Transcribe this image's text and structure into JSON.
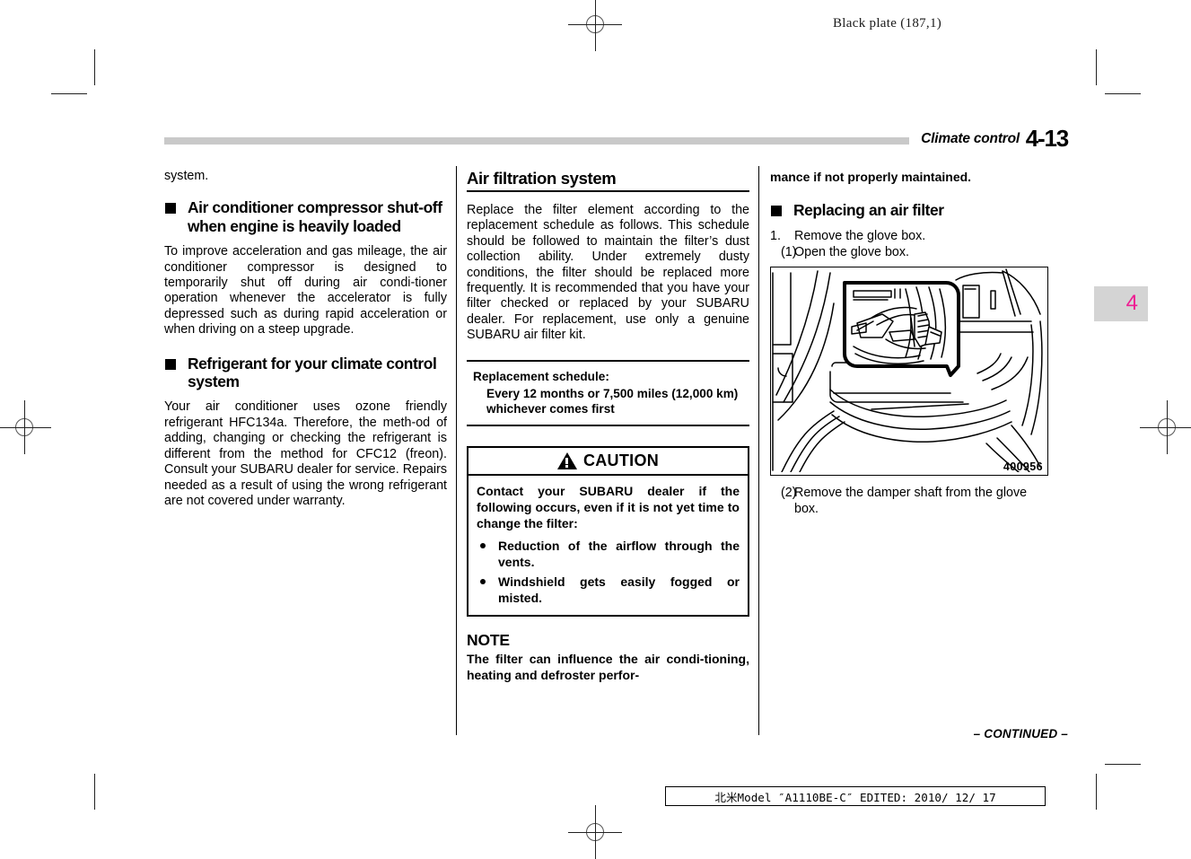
{
  "print_marks": {
    "black_plate": "Black plate (187,1)"
  },
  "running_head": {
    "title": "Climate control",
    "page_number": "4-13"
  },
  "chapter_tab": {
    "number": "4",
    "color": "#ee1d92"
  },
  "column1": {
    "continued_text": "system.",
    "heading1": "Air conditioner compressor shut-off when engine is heavily loaded",
    "paragraph1": "To improve acceleration and gas mileage, the air conditioner compressor is designed to temporarily shut off during air condi-tioner operation whenever the accelerator is fully depressed such as during rapid acceleration or when driving on a steep upgrade.",
    "heading2": "Refrigerant for your climate control system",
    "paragraph2": "Your air conditioner uses ozone friendly refrigerant HFC134a. Therefore, the meth-od of adding, changing or checking the refrigerant is different from the method for CFC12 (freon). Consult your SUBARU dealer for service. Repairs needed as a result of using the wrong refrigerant are not covered under warranty."
  },
  "column2": {
    "section_title": "Air filtration system",
    "paragraph1": "Replace the filter element according to the replacement schedule as follows. This schedule should be followed to maintain the filter’s dust collection ability. Under extremely dusty conditions, the filter should be replaced more frequently. It is recommended that you have your filter checked or replaced by your SUBARU dealer. For replacement, use only a genuine SUBARU air filter kit.",
    "schedule": {
      "title": "Replacement schedule:",
      "detail": "Every 12 months or 7,500 miles (12,000 km) whichever comes first"
    },
    "caution": {
      "label": "CAUTION",
      "icon": "warning-triangle-icon",
      "intro": "Contact your SUBARU dealer if the following occurs, even if it is not yet time to change the filter:",
      "items": [
        "Reduction of the airflow through the vents.",
        "Windshield gets easily fogged or misted."
      ]
    },
    "note": {
      "label": "NOTE",
      "text": "The filter can influence the air condi-tioning, heating and defroster perfor-"
    }
  },
  "column3": {
    "continued_text": "mance if not properly maintained.",
    "heading1": "Replacing an air filter",
    "step1_num": "1.",
    "step1_text": "Remove the glove box.",
    "substep1_num": "(1)",
    "substep1_text": "Open the glove box.",
    "figure_id": "400956",
    "substep2_num": "(2)",
    "substep2_text": "Remove the damper shaft from the glove box."
  },
  "footer": {
    "continued": "– CONTINUED –",
    "stamp": "北米Model ″A1110BE-C″ EDITED:  2010/ 12/ 17"
  }
}
